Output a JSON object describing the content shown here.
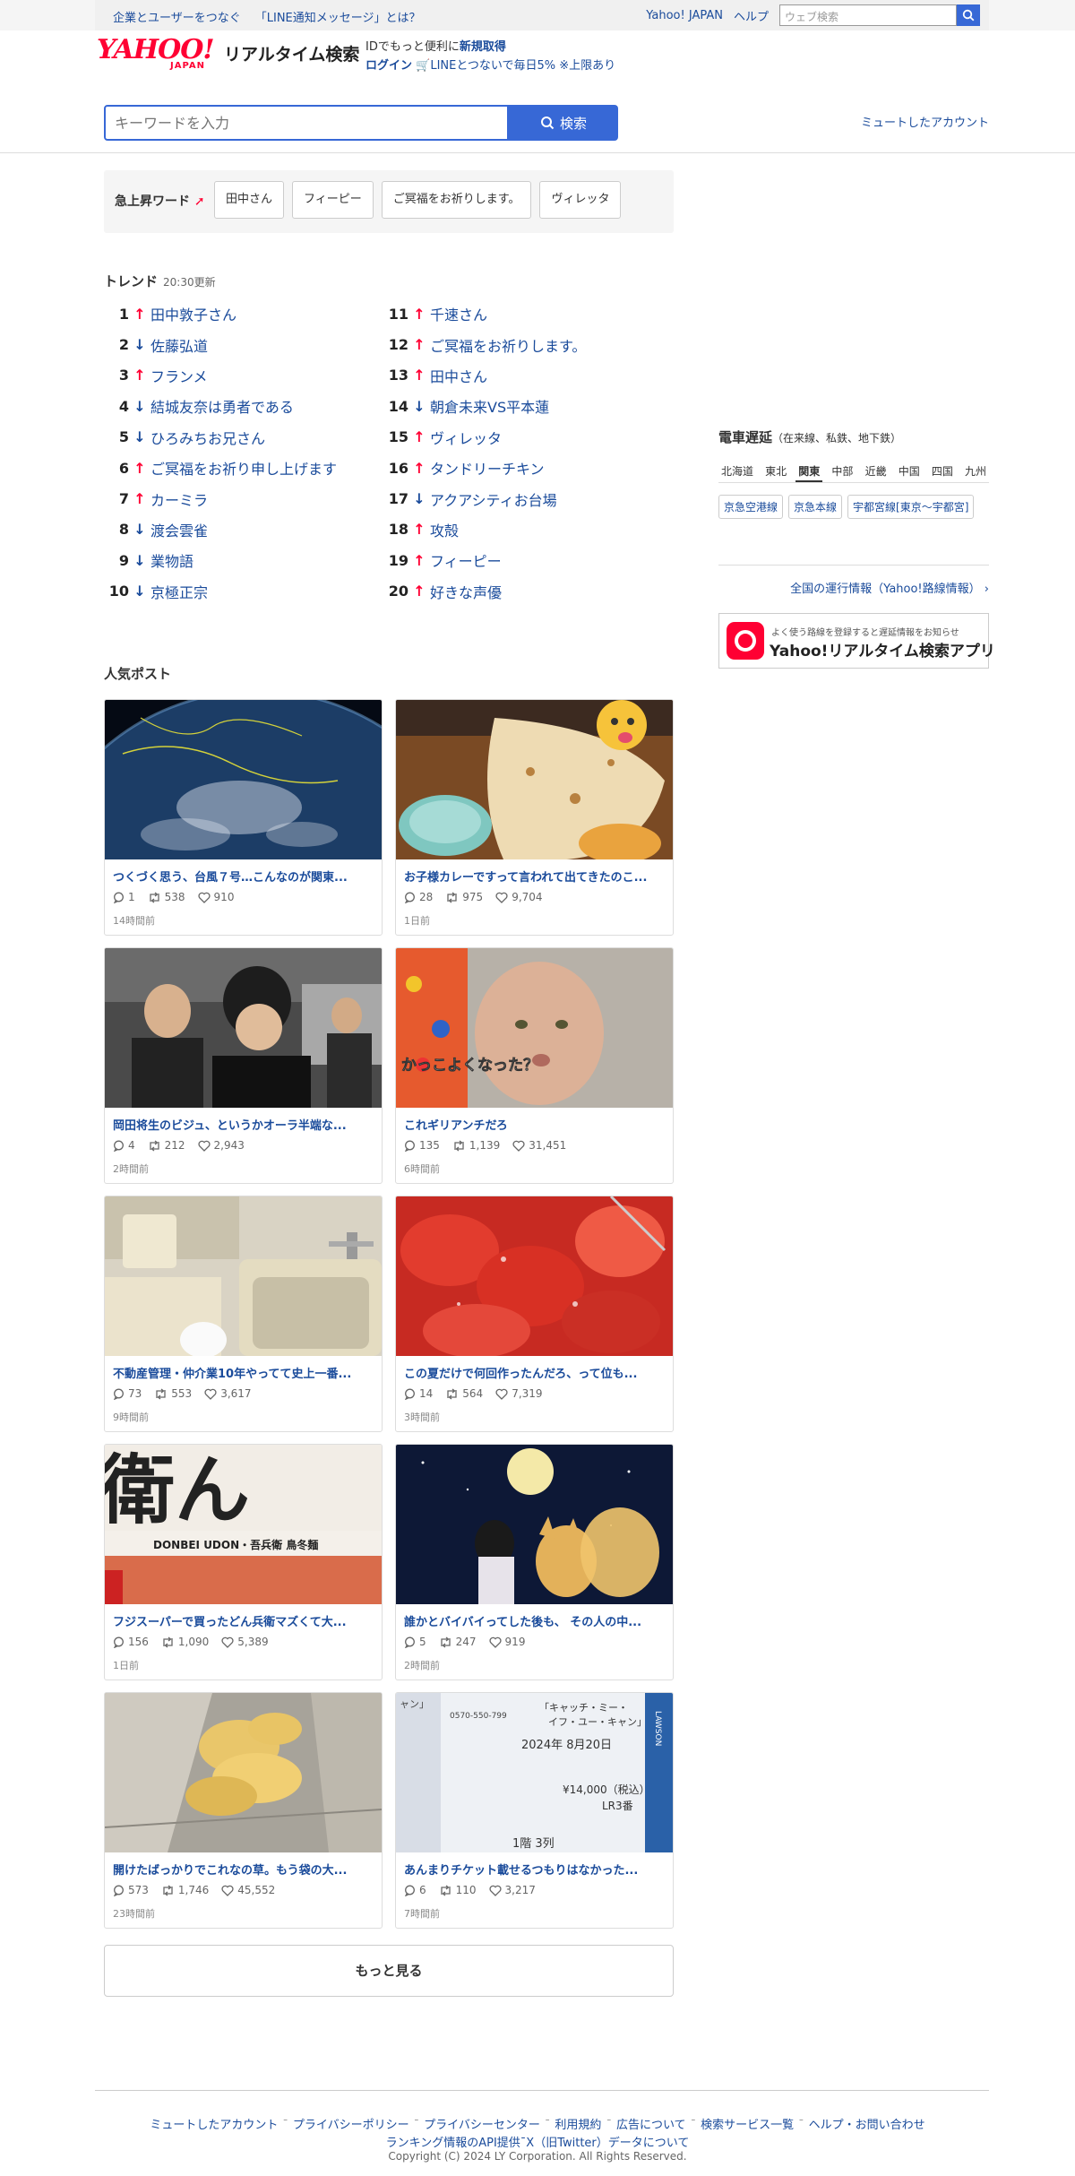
{
  "topbar": {
    "links": [
      "企業とユーザーをつなぐ",
      "「LINE通知メッセージ」とは？"
    ],
    "yahoo_japan": "Yahoo! JAPAN",
    "help": "ヘルプ",
    "web_search_placeholder": "ウェブ検索"
  },
  "header": {
    "logo_main": "YAHOO!",
    "logo_japan": "JAPAN",
    "logo_sub": "リアルタイム検索",
    "promo_line1_prefix": "IDでもっと便利に",
    "promo_line1_link": "新規取得",
    "promo_login": "ログイン",
    "promo_line2": "LINEとつないで毎日5% ※上限あり",
    "search_placeholder": "キーワードを入力",
    "search_button": "検索",
    "muted_accounts": "ミュートしたアカウント"
  },
  "rising": {
    "label": "急上昇ワード",
    "words": [
      "田中さん",
      "フィーピー",
      "ご冥福をお祈りします。",
      "ヴィレッタ"
    ]
  },
  "trends": {
    "title": "トレンド",
    "updated": "20:30更新",
    "items": [
      {
        "rank": "1",
        "dir": "up",
        "word": "田中敦子さん"
      },
      {
        "rank": "2",
        "dir": "down",
        "word": "佐藤弘道"
      },
      {
        "rank": "3",
        "dir": "up",
        "word": "フランメ"
      },
      {
        "rank": "4",
        "dir": "down",
        "word": "結城友奈は勇者である"
      },
      {
        "rank": "5",
        "dir": "down",
        "word": "ひろみちお兄さん"
      },
      {
        "rank": "6",
        "dir": "up",
        "word": "ご冥福をお祈り申し上げます"
      },
      {
        "rank": "7",
        "dir": "up",
        "word": "カーミラ"
      },
      {
        "rank": "8",
        "dir": "down",
        "word": "渡会雲雀"
      },
      {
        "rank": "9",
        "dir": "down",
        "word": "業物語"
      },
      {
        "rank": "10",
        "dir": "down",
        "word": "京極正宗"
      },
      {
        "rank": "11",
        "dir": "up",
        "word": "千速さん"
      },
      {
        "rank": "12",
        "dir": "up",
        "word": "ご冥福をお祈りします。"
      },
      {
        "rank": "13",
        "dir": "up",
        "word": "田中さん"
      },
      {
        "rank": "14",
        "dir": "down",
        "word": "朝倉未来VS平本蓮"
      },
      {
        "rank": "15",
        "dir": "up",
        "word": "ヴィレッタ"
      },
      {
        "rank": "16",
        "dir": "up",
        "word": "タンドリーチキン"
      },
      {
        "rank": "17",
        "dir": "down",
        "word": "アクアシティお台場"
      },
      {
        "rank": "18",
        "dir": "up",
        "word": "攻殻"
      },
      {
        "rank": "19",
        "dir": "up",
        "word": "フィーピー"
      },
      {
        "rank": "20",
        "dir": "up",
        "word": "好きな声優"
      }
    ]
  },
  "train": {
    "title": "電車遅延",
    "subtitle": "（在来線、私鉄、地下鉄）",
    "tabs": [
      "北海道",
      "東北",
      "関東",
      "中部",
      "近畿",
      "中国",
      "四国",
      "九州"
    ],
    "active_tab": "関東",
    "lines": [
      "京急空港線",
      "京急本線",
      "宇都宮線[東京〜宇都宮]"
    ],
    "all_link": "全国の運行情報（Yahoo!路線情報）"
  },
  "app_banner": {
    "small": "よく使う路線を登録すると遅延情報をお知らせ",
    "big": "Yahoo!リアルタイム検索アプリ"
  },
  "posts": {
    "title": "人気ポスト",
    "items": [
      {
        "text": "つくづく思う、台風７号…こんなのが関東...",
        "replies": "1",
        "reposts": "538",
        "likes": "910",
        "time": "14時間前",
        "img": "earth"
      },
      {
        "text": "お子様カレーですって言われて出てきたのこ...",
        "replies": "28",
        "reposts": "975",
        "likes": "9,704",
        "time": "1日前",
        "img": "naan"
      },
      {
        "text": "岡田将生のビジュ、というかオーラ半端な...",
        "replies": "4",
        "reposts": "212",
        "likes": "2,943",
        "time": "2時間前",
        "img": "people"
      },
      {
        "text": "これギリアンチだろ",
        "replies": "135",
        "reposts": "1,139",
        "likes": "31,451",
        "time": "6時間前",
        "img": "baby"
      },
      {
        "text": "不動産管理・仲介業10年やってて史上一番...",
        "replies": "73",
        "reposts": "553",
        "likes": "3,617",
        "time": "9時間前",
        "img": "bath"
      },
      {
        "text": "この夏だけで何回作ったんだろ、って位も...",
        "replies": "14",
        "reposts": "564",
        "likes": "7,319",
        "time": "3時間前",
        "img": "tomato"
      },
      {
        "text": "フジスーパーで買ったどん兵衛マズくて大...",
        "replies": "156",
        "reposts": "1,090",
        "likes": "5,389",
        "time": "1日前",
        "img": "udon"
      },
      {
        "text": "誰かとバイバイってした後も、 その人の中...",
        "replies": "5",
        "reposts": "247",
        "likes": "919",
        "time": "2時間前",
        "img": "fox"
      },
      {
        "text": "開けたばっかりでこれなの草。もう袋の大...",
        "replies": "573",
        "reposts": "1,746",
        "likes": "45,552",
        "time": "23時間前",
        "img": "chips"
      },
      {
        "text": "あんまりチケット載せるつもりはなかった...",
        "replies": "6",
        "reposts": "110",
        "likes": "3,217",
        "time": "7時間前",
        "img": "ticket"
      }
    ],
    "more": "もっと見る"
  },
  "img_texts": {
    "baby_caption": "かっこよくなった？",
    "udon_brand": "DONBEI UDON・吾兵衛 鳥冬麺",
    "ticket_lines": [
      "ャン」",
      "0570-550-799",
      "「キャッチ・ミー・",
      "イフ・ユー・キャン」",
      "2024年 8月20日",
      "¥14,000（税込）",
      "LR3番",
      "1階 3列",
      "LAWSON"
    ]
  },
  "footer": {
    "links": [
      "ミュートしたアカウント",
      "プライバシーポリシー",
      "プライバシーセンター",
      "利用規約",
      "広告について",
      "検索サービス一覧",
      "ヘルプ・お問い合わせ"
    ],
    "api_link": "ランキング情報のAPI提供",
    "x_data": "X（旧Twitter）データについて",
    "copyright": "Copyright (C) 2024 LY Corporation. All Rights Reserved."
  }
}
